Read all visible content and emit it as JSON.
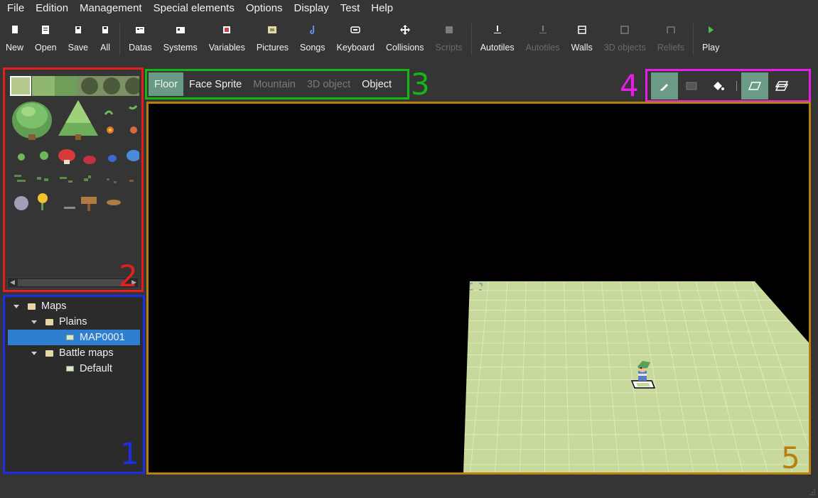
{
  "menubar": {
    "items": [
      "File",
      "Edition",
      "Management",
      "Special elements",
      "Options",
      "Display",
      "Test",
      "Help"
    ]
  },
  "toolbar": {
    "groups": [
      [
        {
          "label": "New",
          "icon": "new-file-icon",
          "enabled": true
        },
        {
          "label": "Open",
          "icon": "open-folder-icon",
          "enabled": true
        },
        {
          "label": "Save",
          "icon": "save-icon",
          "enabled": true
        },
        {
          "label": "All",
          "icon": "save-all-icon",
          "enabled": true
        }
      ],
      [
        {
          "label": "Datas",
          "icon": "datas-icon",
          "enabled": true
        },
        {
          "label": "Systems",
          "icon": "systems-icon",
          "enabled": true
        },
        {
          "label": "Variables",
          "icon": "variables-icon",
          "enabled": true
        },
        {
          "label": "Pictures",
          "icon": "pictures-icon",
          "enabled": true
        },
        {
          "label": "Songs",
          "icon": "music-note-icon",
          "enabled": true
        },
        {
          "label": "Keyboard",
          "icon": "keyboard-icon",
          "enabled": true
        },
        {
          "label": "Collisions",
          "icon": "move-arrows-icon",
          "enabled": true
        },
        {
          "label": "Scripts",
          "icon": "scripts-icon",
          "enabled": false
        }
      ],
      [
        {
          "label": "Autotiles",
          "icon": "autotiles-icon",
          "enabled": true
        },
        {
          "label": "Autotiles",
          "icon": "animated-autotiles-icon",
          "enabled": false
        },
        {
          "label": "Walls",
          "icon": "walls-icon",
          "enabled": true
        },
        {
          "label": "3D objects",
          "icon": "cube-icon",
          "enabled": false
        },
        {
          "label": "Reliefs",
          "icon": "reliefs-icon",
          "enabled": false
        }
      ],
      [
        {
          "label": "Play",
          "icon": "play-icon",
          "enabled": true
        }
      ]
    ]
  },
  "tree": {
    "root": "Maps",
    "folder1": "Plains",
    "map1": "MAP0001",
    "folder2": "Battle maps",
    "map2": "Default"
  },
  "tabs": [
    {
      "label": "Floor",
      "state": "active"
    },
    {
      "label": "Face Sprite",
      "state": "normal"
    },
    {
      "label": "Mountain",
      "state": "disabled"
    },
    {
      "label": "3D object",
      "state": "disabled"
    },
    {
      "label": "Object",
      "state": "normal"
    }
  ],
  "tools": [
    {
      "icon": "pencil-icon",
      "active": true
    },
    {
      "icon": "rectangle-icon",
      "active": false
    },
    {
      "icon": "paint-bucket-icon",
      "active": false
    },
    {
      "icon": "layer-on-icon",
      "active": true
    },
    {
      "icon": "layer-stack-icon",
      "active": false
    }
  ],
  "annotations": {
    "n1": "1",
    "n2": "2",
    "n3": "3",
    "n4": "4",
    "n5": "5"
  },
  "colors": {
    "background": "#353535",
    "panel1_border": "#1e2ee6",
    "panel2_border": "#e61e1e",
    "panel3_border": "#17b617",
    "panel4_border": "#e61ee6",
    "panel5_border": "#b9800f",
    "tab_active": "#6a9a86",
    "selection": "#2f7fd1",
    "floor": "#c7d99b"
  }
}
